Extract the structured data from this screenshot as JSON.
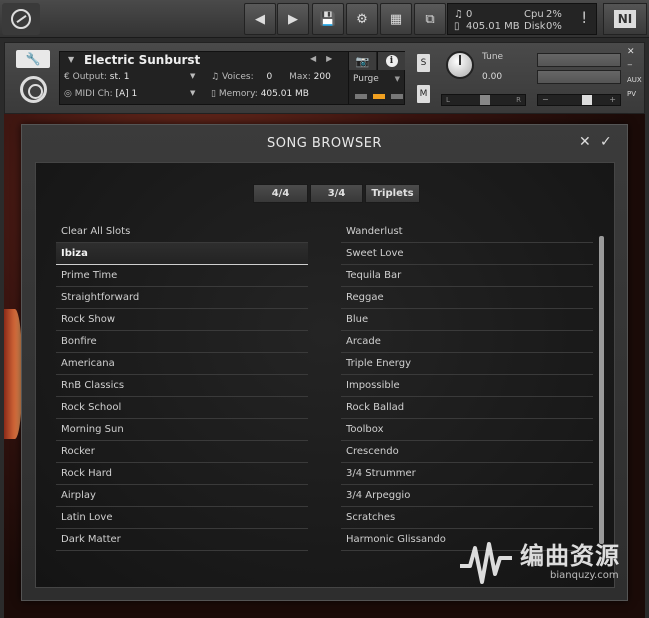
{
  "toolbar": {
    "voices_count": "0",
    "memory": "405.01 MB",
    "cpu_label": "Cpu",
    "cpu_value": "2%",
    "disk_label": "Disk",
    "disk_value": "0%",
    "alert": "!",
    "ni_logo": "NI"
  },
  "instrument": {
    "name": "Electric Sunburst",
    "output_label": "Output:",
    "output_value": "st. 1",
    "voices_label": "Voices:",
    "voices_value": "0",
    "max_label": "Max:",
    "max_value": "200",
    "midi_label": "MIDI Ch:",
    "midi_value": "[A] 1",
    "memory_label": "Memory:",
    "memory_value": "405.01 MB",
    "purge_label": "Purge",
    "solo_label": "S",
    "mute_label": "M",
    "tune_label": "Tune",
    "tune_value": "0.00",
    "pan_left": "L",
    "pan_right": "R",
    "aux_label": "AUX",
    "pv_label": "PV",
    "accent_color": "#f0a020"
  },
  "browser": {
    "title": "SONG BROWSER",
    "close_label": "✕",
    "confirm_label": "✓",
    "tabs": [
      "4/4",
      "3/4",
      "Triplets"
    ],
    "left_items": [
      "Clear All Slots",
      "Ibiza",
      "Prime Time",
      "Straightforward",
      "Rock Show",
      "Bonfire",
      "Americana",
      "RnB Classics",
      "Rock School",
      "Morning Sun",
      "Rocker",
      "Rock Hard",
      "Airplay",
      "Latin Love",
      "Dark Matter"
    ],
    "right_items": [
      "Wanderlust",
      "Sweet Love",
      "Tequila Bar",
      "Reggae",
      "Blue",
      "Arcade",
      "Triple Energy",
      "Impossible",
      "Rock Ballad",
      "Toolbox",
      "Crescendo",
      "3/4 Strummer",
      "3/4 Arpeggio",
      "Scratches",
      "Harmonic Glissando"
    ],
    "selected_left": "Ibiza"
  },
  "watermark": {
    "text": "编曲资源",
    "url": "bianquzy.com"
  }
}
